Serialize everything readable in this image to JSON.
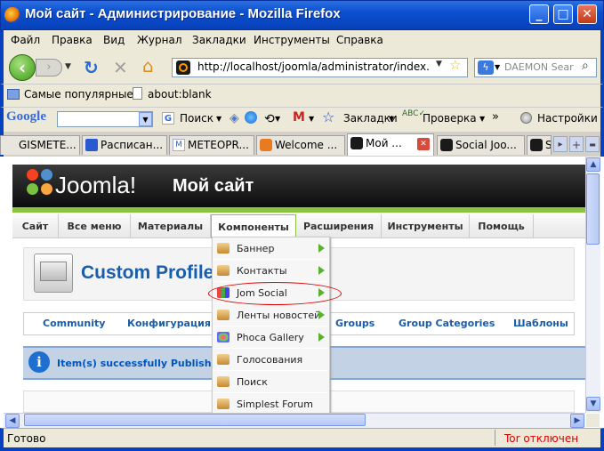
{
  "window": {
    "title": "Мой сайт - Администрирование - Mozilla Firefox"
  },
  "menubar": [
    "Файл",
    "Правка",
    "Вид",
    "Журнал",
    "Закладки",
    "Инструменты",
    "Справка"
  ],
  "navbar": {
    "url": "http://localhost/joomla/administrator/index.ph",
    "search_placeholder": "DAEMON Sear"
  },
  "bookmarks": {
    "popular": "Самые популярные",
    "blank": "about:blank"
  },
  "google_bar": {
    "logo": "Google",
    "search": "Поиск",
    "bookmarks": "Закладки",
    "check": "Проверка",
    "more": "»",
    "settings": "Настройки"
  },
  "tabs": [
    {
      "label": "GISMETE..."
    },
    {
      "label": "Расписан..."
    },
    {
      "label": "METEOPR..."
    },
    {
      "label": "Welcome ..."
    },
    {
      "label": "Мой ...",
      "selected": true
    },
    {
      "label": "Social Joo..."
    },
    {
      "label": "S"
    }
  ],
  "joomla": {
    "logo": "Joomla!",
    "site_name": "Мой сайт",
    "menu": [
      "Сайт",
      "Все меню",
      "Материалы",
      "Компоненты",
      "Расширения",
      "Инструменты",
      "Помощь"
    ],
    "active_menu": "Компоненты",
    "page_title": "Custom Profile",
    "submenu": [
      "Community",
      "Конфигурация",
      "Groups",
      "Group Categories",
      "Шаблоны"
    ],
    "message": "Item(s) successfully Published"
  },
  "dropdown": [
    {
      "label": "Баннер",
      "has_sub": true
    },
    {
      "label": "Контакты",
      "has_sub": true
    },
    {
      "label": "Jom Social",
      "has_sub": true,
      "highlighted": true
    },
    {
      "label": "Ленты новостей",
      "has_sub": true
    },
    {
      "label": "Phoca Gallery",
      "has_sub": true
    },
    {
      "label": "Голосования",
      "has_sub": false
    },
    {
      "label": "Поиск",
      "has_sub": false
    },
    {
      "label": "Simplest Forum",
      "has_sub": false
    }
  ],
  "statusbar": {
    "status": "Готово",
    "tor": "Tor отключен"
  }
}
